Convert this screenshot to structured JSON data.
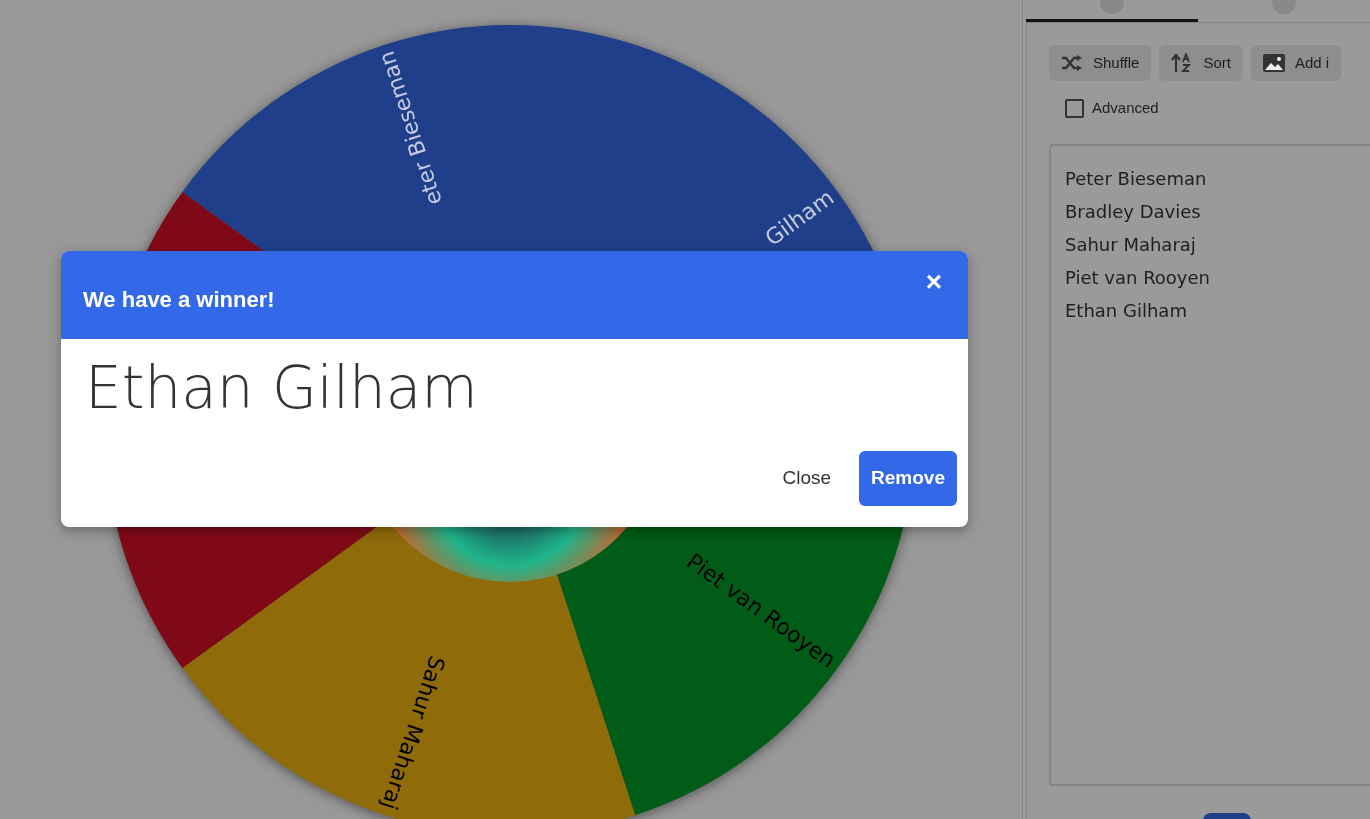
{
  "wheel": {
    "segments": [
      {
        "label": "eter Bieseman",
        "color": "#1f3f8b"
      },
      {
        "label": "Gilham",
        "color": "#1f3f8b"
      },
      {
        "label": "Piet van Rooyen",
        "color": "#005c16"
      },
      {
        "label": "Sahur Maharaj",
        "color": "#8f6b0a"
      },
      {
        "color": "#800917"
      }
    ]
  },
  "sidebar": {
    "tabs": [
      {
        "selected": true
      },
      {
        "selected": false
      }
    ],
    "toolbar": [
      "Shuffle",
      "Sort",
      "Add i"
    ],
    "advanced": {
      "label": "Advanced",
      "checked": false
    },
    "entries": [
      "Peter Bieseman",
      "Bradley Davies",
      "Sahur Maharaj",
      "Piet van Rooyen",
      "Ethan Gilham"
    ]
  },
  "dialog": {
    "title": "We have a winner!",
    "close_glyph": "×",
    "winner": "Ethan Gilham",
    "buttons": [
      {
        "label": "Close",
        "kind": "text"
      },
      {
        "label": "Remove",
        "kind": "primary"
      }
    ]
  }
}
